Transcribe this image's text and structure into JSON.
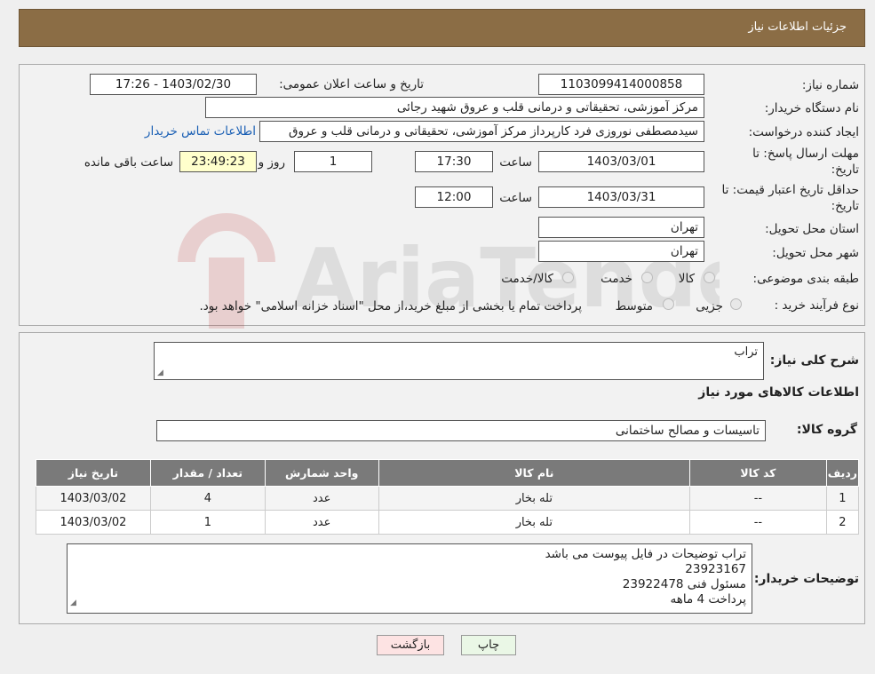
{
  "header": {
    "title": "جزئیات اطلاعات نیاز"
  },
  "watermark": {
    "text": "AriaTender.neT"
  },
  "form": {
    "need_number_label": "شماره نیاز:",
    "need_number": "1103099414000858",
    "announce_label": "تاریخ و ساعت اعلان عمومی:",
    "announce_value": "1403/02/30 - 17:26",
    "buyer_org_label": "نام دستگاه خریدار:",
    "buyer_org": "مرکز آموزشی، تحقیقاتی و درمانی قلب و عروق شهید رجائی",
    "creator_label": "ایجاد کننده درخواست:",
    "creator": "سیدمصطفی نوروزی فرد کارپرداز مرکز آموزشی، تحقیقاتی و درمانی قلب و عروق",
    "contact_link": "اطلاعات تماس خریدار",
    "deadline_label_1": "مهلت ارسال پاسخ: تا",
    "deadline_label_2": "تاریخ:",
    "deadline_date": "1403/03/01",
    "time_label": "ساعت",
    "deadline_time": "17:30",
    "days_value": "1",
    "days_label": "روز و",
    "remaining_time": "23:49:23",
    "remaining_label": "ساعت باقی مانده",
    "validity_label_1": "حداقل تاریخ اعتبار قیمت: تا",
    "validity_label_2": "تاریخ:",
    "validity_date": "1403/03/31",
    "validity_time_label": "ساعت",
    "validity_time": "12:00",
    "province_label": "استان محل تحویل:",
    "province": "تهران",
    "city_label": "شهر محل تحویل:",
    "city": "تهران",
    "category_label": "طبقه بندی موضوعی:",
    "category_options": [
      "کالا",
      "خدمت",
      "کالا/خدمت"
    ],
    "process_label": "نوع فرآیند خرید :",
    "process_options": [
      "جزیی",
      "متوسط"
    ],
    "process_note": "پرداخت تمام یا بخشی از مبلغ خرید،از محل \"اسناد خزانه اسلامی\" خواهد بود."
  },
  "details": {
    "summary_label": "شرح کلی نیاز:",
    "summary": "تراب",
    "goods_title": "اطلاعات کالاهای مورد نیاز",
    "group_label": "گروه کالا:",
    "group": "تاسیسات و مصالح ساختمانی",
    "table": {
      "headers": [
        "ردیف",
        "کد کالا",
        "نام کالا",
        "واحد شمارش",
        "تعداد / مقدار",
        "تاریخ نیاز"
      ],
      "rows": [
        [
          "1",
          "--",
          "تله بخار",
          "عدد",
          "4",
          "1403/03/02"
        ],
        [
          "2",
          "--",
          "تله بخار",
          "عدد",
          "1",
          "1403/03/02"
        ]
      ]
    },
    "buyer_notes_label": "توضیحات خریدار:",
    "buyer_notes": [
      "تراب  توضیحات در فایل پیوست می باشد",
      "23923167",
      "مسئول فنی 23922478",
      "پرداخت 4 ماهه"
    ]
  },
  "buttons": {
    "print": "چاپ",
    "back": "بازگشت"
  }
}
